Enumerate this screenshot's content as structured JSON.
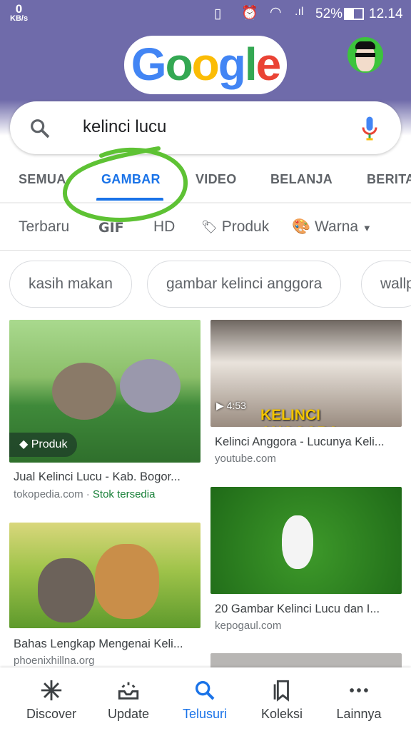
{
  "status_bar": {
    "speed_value": "0",
    "speed_unit": "KB/s",
    "battery": "52%",
    "time": "12.14"
  },
  "header": {
    "logo": "Google"
  },
  "search": {
    "query": "kelinci lucu"
  },
  "tabs": [
    {
      "label": "SEMUA"
    },
    {
      "label": "GAMBAR",
      "active": true
    },
    {
      "label": "VIDEO"
    },
    {
      "label": "BELANJA"
    },
    {
      "label": "BERITA"
    }
  ],
  "filters": [
    {
      "label": "Terbaru"
    },
    {
      "label": "GIF"
    },
    {
      "label": "HD"
    },
    {
      "label": "Produk",
      "icon": "tag-icon"
    },
    {
      "label": "Warna",
      "icon": "palette-icon"
    }
  ],
  "chips": [
    {
      "label": "kasih makan"
    },
    {
      "label": "gambar kelinci anggora"
    },
    {
      "label": "wallpaper"
    }
  ],
  "results": [
    {
      "title": "Jual Kelinci Lucu - Kab. Bogor...",
      "domain": "tokopedia.com",
      "stock": "Stok tersedia",
      "badge": "Produk"
    },
    {
      "title": "Kelinci Anggora - Lucunya Keli...",
      "domain": "youtube.com",
      "duration": "4:53",
      "overlay": "KELINCI ANGGORA"
    },
    {
      "title": "Bahas Lengkap Mengenai Keli...",
      "domain": "phoenixhillna.org"
    },
    {
      "title": "20 Gambar Kelinci Lucu dan I...",
      "domain": "kepogaul.com"
    }
  ],
  "bottom_nav": [
    {
      "label": "Discover"
    },
    {
      "label": "Update"
    },
    {
      "label": "Telusuri",
      "active": true
    },
    {
      "label": "Koleksi"
    },
    {
      "label": "Lainnya"
    }
  ],
  "colors": {
    "header": "#6f6baa",
    "accent": "#1a73e8",
    "annotation": "#5ec234",
    "stock": "#188038"
  }
}
